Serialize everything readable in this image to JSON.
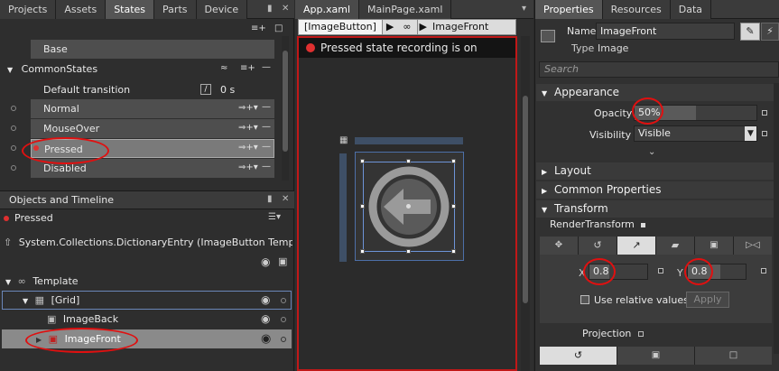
{
  "left_tabs": [
    "Projects",
    "Assets",
    "States",
    "Parts",
    "Device"
  ],
  "states": {
    "base": "Base",
    "group": "CommonStates",
    "default_transition": "Default transition",
    "transition_time": "0 s",
    "items": [
      "Normal",
      "MouseOver",
      "Pressed",
      "Disabled"
    ]
  },
  "objects": {
    "title": "Objects and Timeline",
    "state": "Pressed",
    "scope": "System.Collections.DictionaryEntry (ImageButton Templa...",
    "template": "Template",
    "grid": "[Grid]",
    "image_back": "ImageBack",
    "image_front": "ImageFront"
  },
  "doc_tabs": [
    "App.xaml",
    "MainPage.xaml"
  ],
  "breadcrumb": {
    "first": "[ImageButton]",
    "last": "ImageFront"
  },
  "recording": "Pressed state recording is on",
  "right_tabs": [
    "Properties",
    "Resources",
    "Data"
  ],
  "props": {
    "name_label": "Name",
    "name_value": "ImageFront",
    "type_label": "Type",
    "type_value": "Image",
    "search_placeholder": "Search",
    "appearance": "Appearance",
    "opacity_label": "Opacity",
    "opacity_value": "50%",
    "opacity_fraction": 0.5,
    "visibility_label": "Visibility",
    "visibility_value": "Visible",
    "layout": "Layout",
    "common": "Common Properties",
    "transform": "Transform",
    "render_transform": "RenderTransform",
    "x_label": "X",
    "x_value": "0.8",
    "y_label": "Y",
    "y_value": "0.8",
    "relative": "Use relative values",
    "apply": "Apply",
    "projection": "Projection"
  },
  "colors": {
    "accent": "#e01010",
    "recording": "#e03030",
    "selection": "#7a7a7a"
  }
}
